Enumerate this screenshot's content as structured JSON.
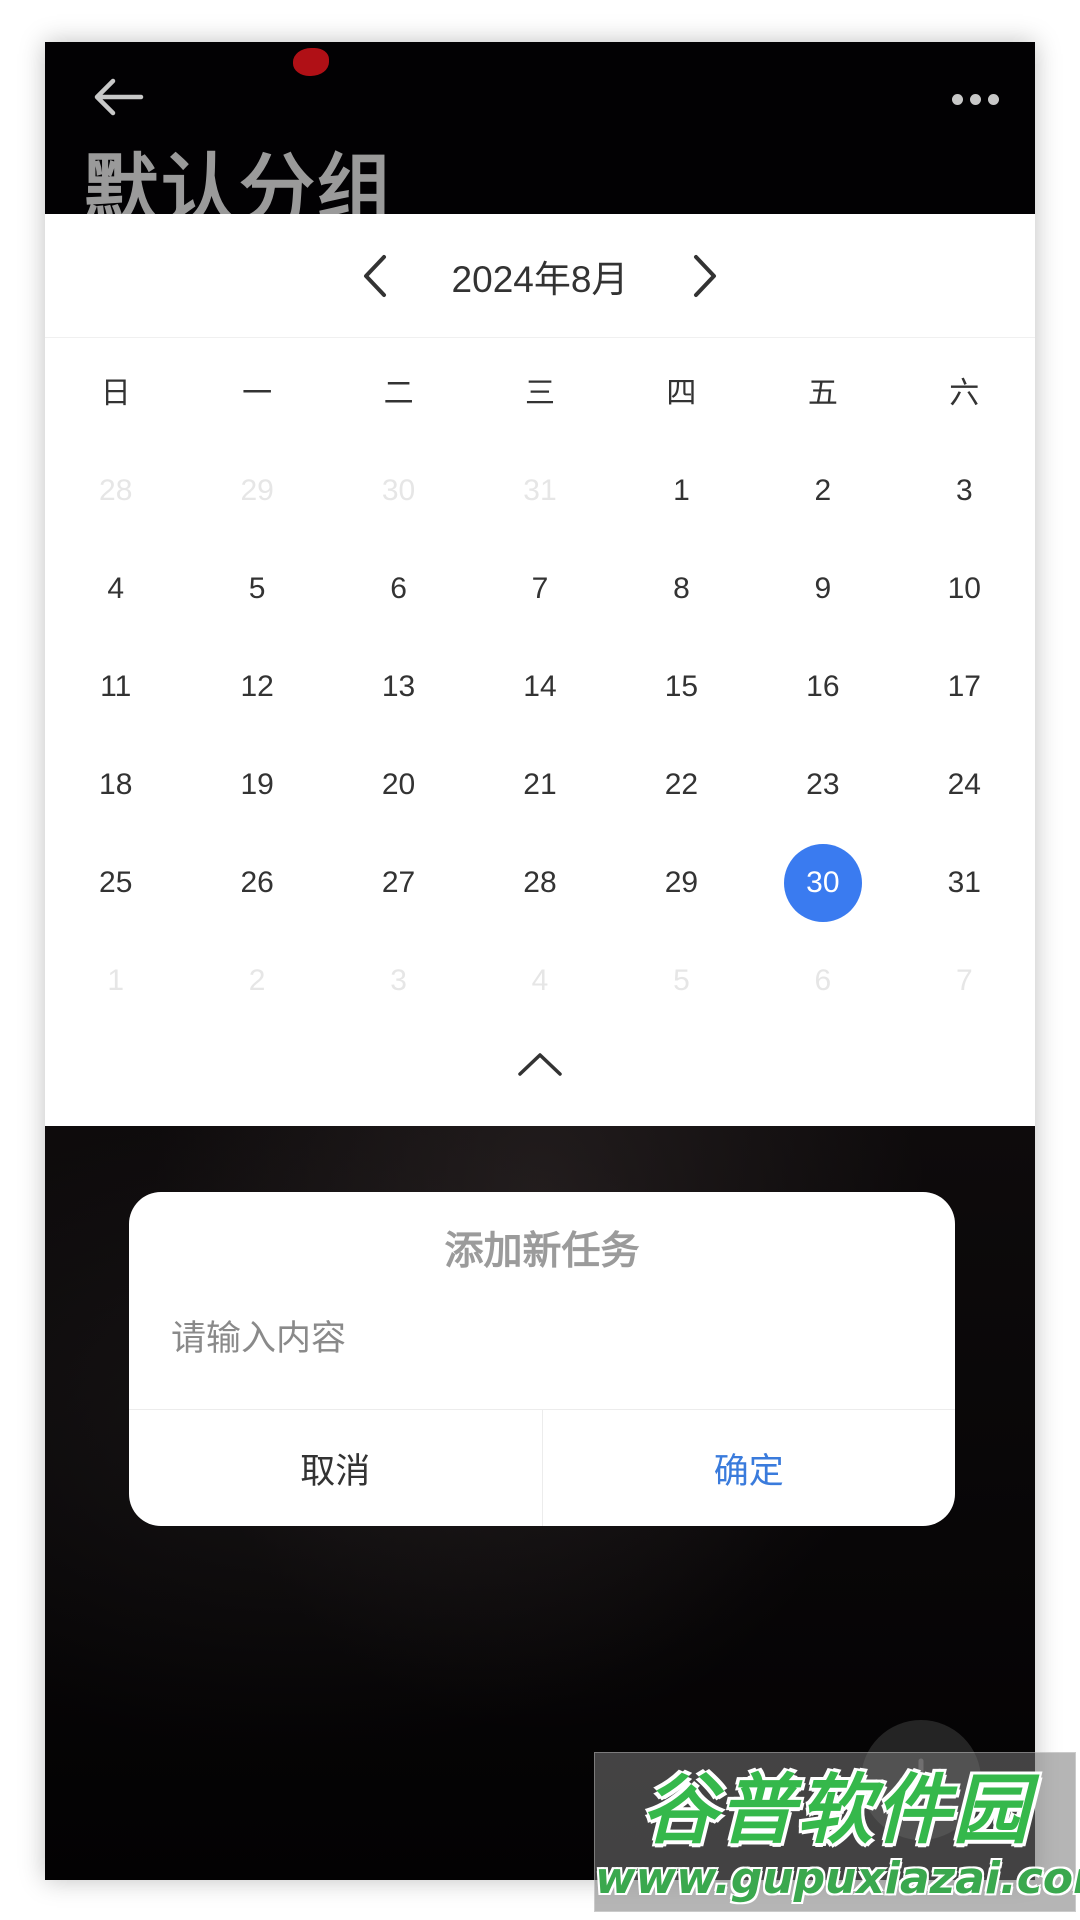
{
  "header": {
    "title": "默认分组",
    "back_icon": "arrow-left-icon",
    "more_icon": "more-horizontal-icon"
  },
  "calendar": {
    "month_label": "2024年8月",
    "weekdays": [
      "日",
      "一",
      "二",
      "三",
      "四",
      "五",
      "六"
    ],
    "weeks": [
      [
        "28",
        "29",
        "30",
        "31",
        "1",
        "2",
        "3"
      ],
      [
        "4",
        "5",
        "6",
        "7",
        "8",
        "9",
        "10"
      ],
      [
        "11",
        "12",
        "13",
        "14",
        "15",
        "16",
        "17"
      ],
      [
        "18",
        "19",
        "20",
        "21",
        "22",
        "23",
        "24"
      ],
      [
        "25",
        "26",
        "27",
        "28",
        "29",
        "30",
        "31"
      ],
      [
        "1",
        "2",
        "3",
        "4",
        "5",
        "6",
        "7"
      ]
    ],
    "outside_month": [
      [
        0,
        0
      ],
      [
        0,
        1
      ],
      [
        0,
        2
      ],
      [
        0,
        3
      ],
      [
        5,
        0
      ],
      [
        5,
        1
      ],
      [
        5,
        2
      ],
      [
        5,
        3
      ],
      [
        5,
        4
      ],
      [
        5,
        5
      ],
      [
        5,
        6
      ]
    ],
    "selected_day": "30",
    "selected_color": "#3a7bf0"
  },
  "dialog": {
    "title": "添加新任务",
    "input_placeholder": "请输入内容",
    "input_value": "",
    "cancel_label": "取消",
    "confirm_label": "确定",
    "confirm_color": "#3a7bdc"
  },
  "watermark": {
    "logo_text": "谷普软件园",
    "url_text": "www.gupuxiazai.com"
  }
}
